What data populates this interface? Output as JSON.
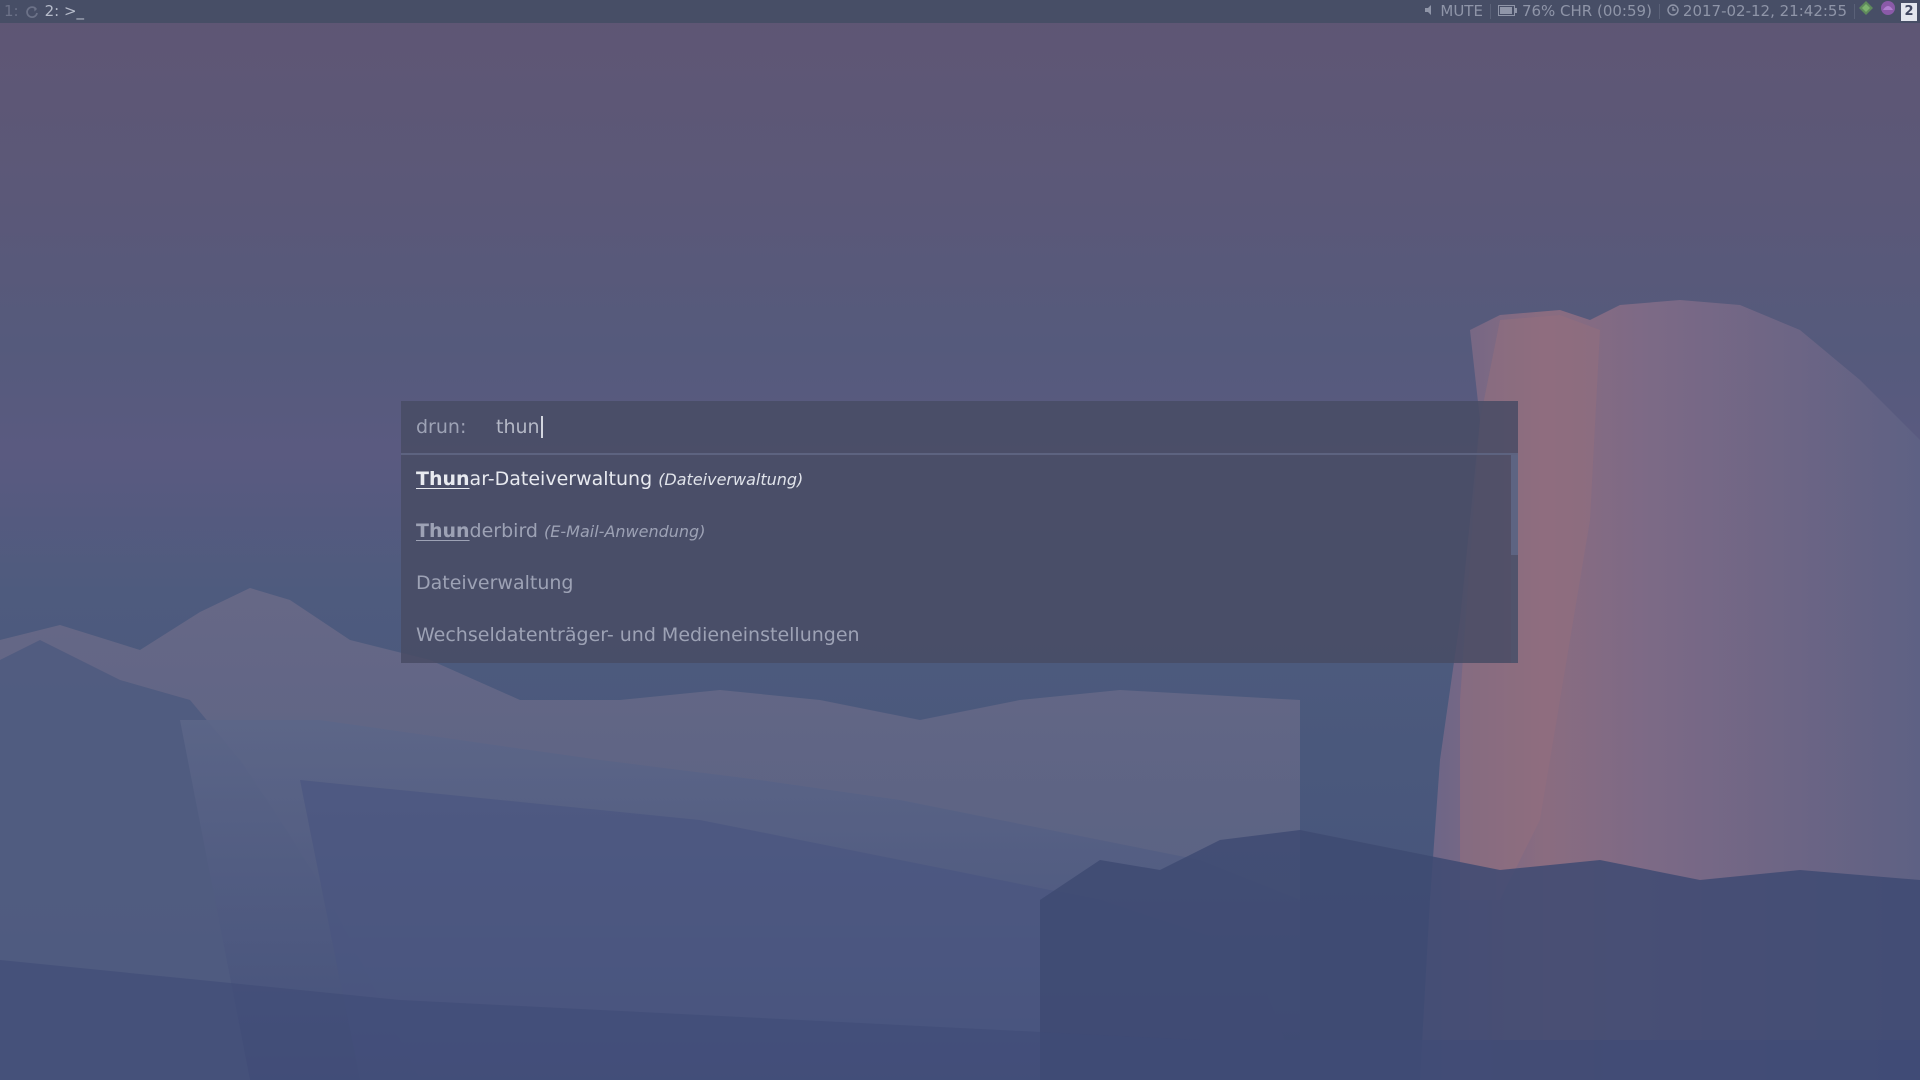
{
  "colors": {
    "bar_bg": "#474e66",
    "launcher_bg": "#484c64",
    "text_dim": "#9da2b5",
    "text_selected": "#e8eaf0"
  },
  "topbar": {
    "workspaces": [
      {
        "label": "1:",
        "active": false,
        "icon": "refresh-icon"
      },
      {
        "label": "2: >_",
        "active": true
      }
    ],
    "volume": {
      "icon": "speaker-icon",
      "label": "MUTE"
    },
    "battery": {
      "icon": "battery-icon",
      "label": "76% CHR (00:59)"
    },
    "clock": {
      "icon": "clock-icon",
      "label": "2017-02-12, 21:42:55"
    },
    "tray": {
      "icons": [
        "network-icon",
        "app-icon"
      ],
      "badge": "2"
    }
  },
  "launcher": {
    "mode_label": "drun:",
    "query": "thun",
    "results": [
      {
        "match": "Thun",
        "rest": "ar-Dateiverwaltung",
        "category": "(Dateiverwaltung)",
        "selected": true
      },
      {
        "match": "Thun",
        "rest": "derbird",
        "category": "(E-Mail-Anwendung)",
        "selected": false
      },
      {
        "match": "",
        "rest": "Dateiverwaltung",
        "category": "",
        "selected": false
      },
      {
        "match": "",
        "rest": "Wechseldatenträger- und Medieneinstellungen",
        "category": "",
        "selected": false
      }
    ]
  }
}
